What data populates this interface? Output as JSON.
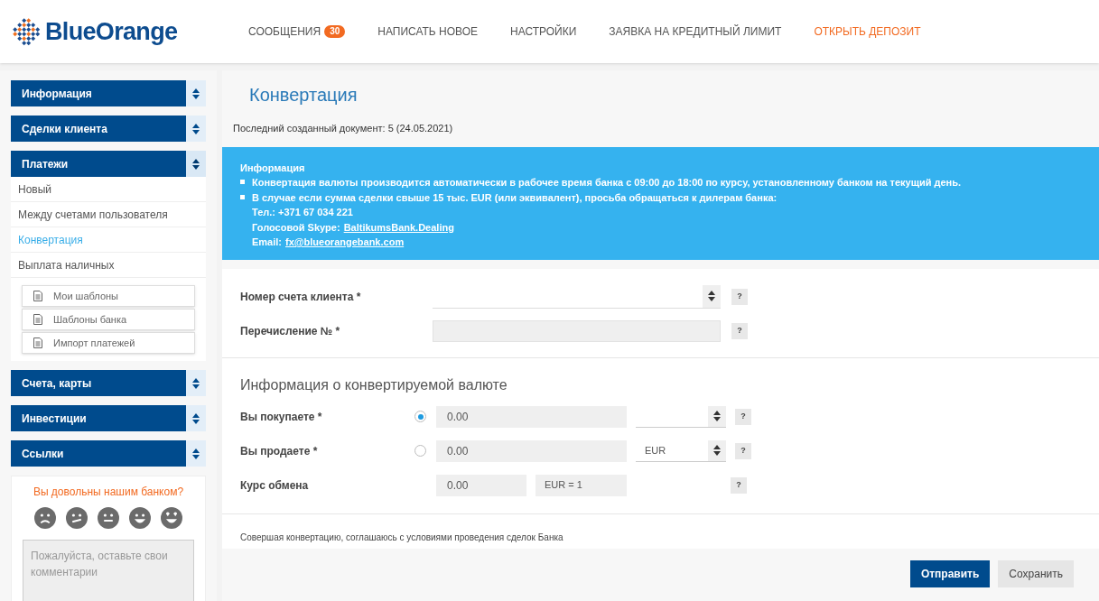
{
  "header": {
    "logo": "BlueOrange",
    "nav": [
      {
        "label": "СООБЩЕНИЯ",
        "badge": "30",
        "highlight": false
      },
      {
        "label": "НАПИСАТЬ НОВОЕ",
        "highlight": false
      },
      {
        "label": "НАСТРОЙКИ",
        "highlight": false
      },
      {
        "label": "ЗАЯВКА НА КРЕДИТНЫЙ ЛИМИТ",
        "highlight": false
      },
      {
        "label": "ОТКРЫТЬ ДЕПОЗИТ",
        "highlight": true
      }
    ]
  },
  "sidebar": {
    "sections": [
      {
        "title": "Информация",
        "expanded": false
      },
      {
        "title": "Сделки клиента",
        "expanded": false
      },
      {
        "title": "Платежи",
        "expanded": true,
        "items": [
          {
            "label": "Новый",
            "selected": false
          },
          {
            "label": "Между счетами пользователя",
            "selected": false
          },
          {
            "label": "Конвертация",
            "selected": true
          },
          {
            "label": "Выплата наличных",
            "selected": false
          }
        ],
        "tools": [
          "Мои шаблоны",
          "Шаблоны банка",
          "Импорт платежей"
        ]
      },
      {
        "title": "Счета, карты",
        "expanded": false
      },
      {
        "title": "Инвестиции",
        "expanded": false
      },
      {
        "title": "Ссылки",
        "expanded": false
      }
    ],
    "feedback": {
      "question": "Вы довольны нашим банком?",
      "placeholder": "Пожалуйста, оставьте свои комментарии"
    }
  },
  "main": {
    "title": "Конвертация",
    "last_document": {
      "label": "Последний созданный документ:",
      "value": "5 (24.05.2021)"
    },
    "info": {
      "title": "Информация",
      "bullets": [
        "Конвертация валюты производится автоматически в рабочее время банка с 09:00 до 18:00 по курсу, установленному банком на текущий день.",
        "В случае если сумма сделки свыше 15 тыс. EUR (или эквивалент), просьба обращаться к дилерам банка:"
      ],
      "contacts": [
        {
          "label": "Тел.: +371 67 034 221"
        },
        {
          "label": "Голосовой Skype:",
          "link": "BaltikumsBank.Dealing"
        },
        {
          "label": "Email:",
          "link": "fx@blueorangebank.com"
        }
      ]
    },
    "account_fields": [
      {
        "kind": "select",
        "label": "Номер счета клиента *",
        "help": "?"
      },
      {
        "kind": "input",
        "label": "Перечисление № *",
        "help": "?"
      }
    ],
    "currency": {
      "title": "Информация о конвертируемой валюте",
      "rows": [
        {
          "kind": "radio",
          "label": "Вы покупаете *",
          "selected": true,
          "amount": "0.00",
          "help": "?"
        },
        {
          "kind": "radio",
          "label": "Вы продаете *",
          "selected": false,
          "amount": "0.00",
          "currency": "EUR",
          "help": "?"
        },
        {
          "kind": "rate",
          "label": "Курс обмена",
          "amount": "0.00",
          "rate": "EUR = 1",
          "help": "?"
        }
      ]
    },
    "agreement": "Совершая конвертацию, соглашаюсь с условиями проведения сделок Банка",
    "buttons": [
      {
        "label": "Отправить",
        "kind": "primary"
      },
      {
        "label": "Сохранить",
        "kind": "secondary"
      }
    ]
  }
}
